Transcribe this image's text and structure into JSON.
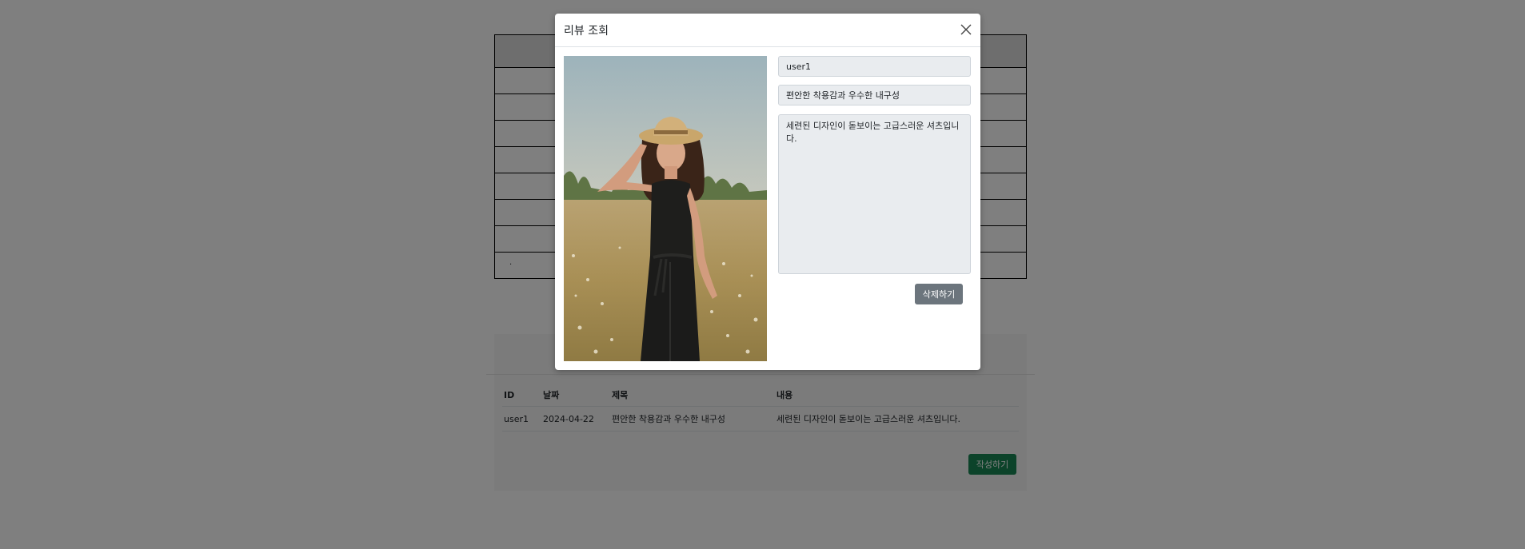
{
  "modal": {
    "title": "리뷰 조회",
    "user_id": "user1",
    "review_title": "편안한 착용감과 우수한 내구성",
    "review_content": "세련된 디자인이 돋보이는 고급스러운 셔츠입니다.",
    "delete_label": "삭제하기"
  },
  "review_list": {
    "columns": [
      "ID",
      "날짜",
      "제목",
      "내용"
    ],
    "rows": [
      {
        "id": "user1",
        "date": "2024-04-22",
        "title": "편안한 착용감과 우수한 내구성",
        "content": "세련된 디자인이 돋보이는 고급스러운 셔츠입니다."
      }
    ],
    "write_label": "작성하기"
  },
  "background_table": {
    "last_row_mark": "."
  },
  "colors": {
    "backdrop": "rgba(0,0,0,0.5)",
    "delete_button": "#6c757d",
    "write_button": "#198754"
  },
  "icons": {
    "close": "close-icon"
  }
}
